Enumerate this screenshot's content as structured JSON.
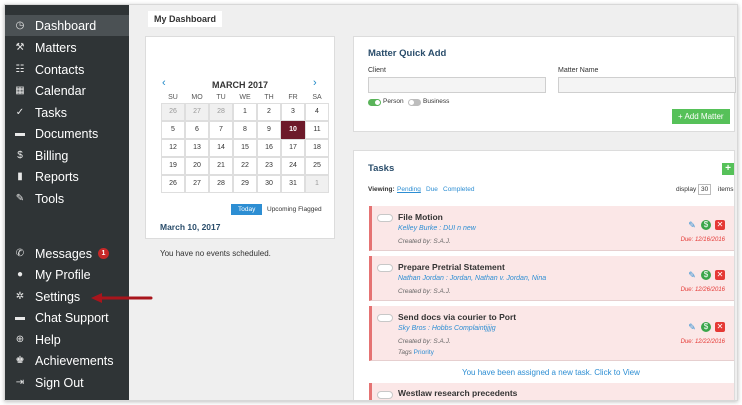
{
  "sidebar": {
    "items": [
      {
        "label": "Dashboard",
        "icon": "clock-icon",
        "glyph": "◷"
      },
      {
        "label": "Matters",
        "icon": "gavel-icon",
        "glyph": "⚒"
      },
      {
        "label": "Contacts",
        "icon": "contacts-icon",
        "glyph": "☷"
      },
      {
        "label": "Calendar",
        "icon": "calendar-icon",
        "glyph": "▦"
      },
      {
        "label": "Tasks",
        "icon": "check-icon",
        "glyph": "✓"
      },
      {
        "label": "Documents",
        "icon": "folder-icon",
        "glyph": "▬"
      },
      {
        "label": "Billing",
        "icon": "dollar-icon",
        "glyph": "$"
      },
      {
        "label": "Reports",
        "icon": "bar-chart-icon",
        "glyph": "▮"
      },
      {
        "label": "Tools",
        "icon": "wrench-icon",
        "glyph": "✎"
      }
    ],
    "bottom_items": [
      {
        "label": "Messages",
        "icon": "phone-icon",
        "glyph": "✆",
        "badge": "1"
      },
      {
        "label": "My Profile",
        "icon": "user-icon",
        "glyph": "●"
      },
      {
        "label": "Settings",
        "icon": "gear-icon",
        "glyph": "✲"
      },
      {
        "label": "Chat Support",
        "icon": "chat-icon",
        "glyph": "▬"
      },
      {
        "label": "Help",
        "icon": "lifebuoy-icon",
        "glyph": "⊕"
      },
      {
        "label": "Achievements",
        "icon": "trophy-icon",
        "glyph": "♚"
      },
      {
        "label": "Sign Out",
        "icon": "sign-out-icon",
        "glyph": "⇥"
      }
    ]
  },
  "page": {
    "breadcrumb": "My Dashboard"
  },
  "calendar": {
    "month": "MARCH 2017",
    "prev": "‹",
    "next": "›",
    "weekdays": [
      "SU",
      "MO",
      "TU",
      "WE",
      "TH",
      "FR",
      "SA"
    ],
    "weeks": [
      [
        "26",
        "27",
        "28",
        "1",
        "2",
        "3",
        "4"
      ],
      [
        "5",
        "6",
        "7",
        "8",
        "9",
        "10",
        "11"
      ],
      [
        "12",
        "13",
        "14",
        "15",
        "16",
        "17",
        "18"
      ],
      [
        "19",
        "20",
        "21",
        "22",
        "23",
        "24",
        "25"
      ],
      [
        "26",
        "27",
        "28",
        "29",
        "30",
        "31",
        "1"
      ]
    ],
    "today_button": "Today",
    "flag_button": "Upcoming Flagged",
    "selected_date": "March 10, 2017",
    "empty_message": "You have no events scheduled."
  },
  "quick_add": {
    "title": "Matter Quick Add",
    "client_label": "Client",
    "matter_label": "Matter Name",
    "person_label": "Person",
    "business_label": "Business",
    "add_button": "+ Add Matter"
  },
  "tasks": {
    "title": "Tasks",
    "viewing_label": "Viewing:",
    "filters": [
      "Pending",
      "Due",
      "Completed"
    ],
    "display_label": "display",
    "display_value": "30",
    "items_label": "items",
    "items": [
      {
        "title": "File Motion",
        "matter": "Kelley Burke : DUI n new",
        "created_by": "Created by: S.A.J.",
        "due": "Due: 12/16/2016"
      },
      {
        "title": "Prepare Pretrial Statement",
        "matter": "Nathan Jordan : Jordan, Nathan v. Jordan, Nina",
        "created_by": "Created by: S.A.J.",
        "due": "Due: 12/26/2016"
      },
      {
        "title": "Send docs via courier to Port",
        "matter": "Sky Bros : Hobbs Complaintjjjjg",
        "created_by": "Created by: S.A.J.",
        "tags_label": "Tags",
        "tag": "Priority",
        "due": "Due: 12/22/2016"
      }
    ],
    "notice": "You have been assigned a new task. Click to View",
    "next_item_title": "Westlaw research precedents"
  }
}
